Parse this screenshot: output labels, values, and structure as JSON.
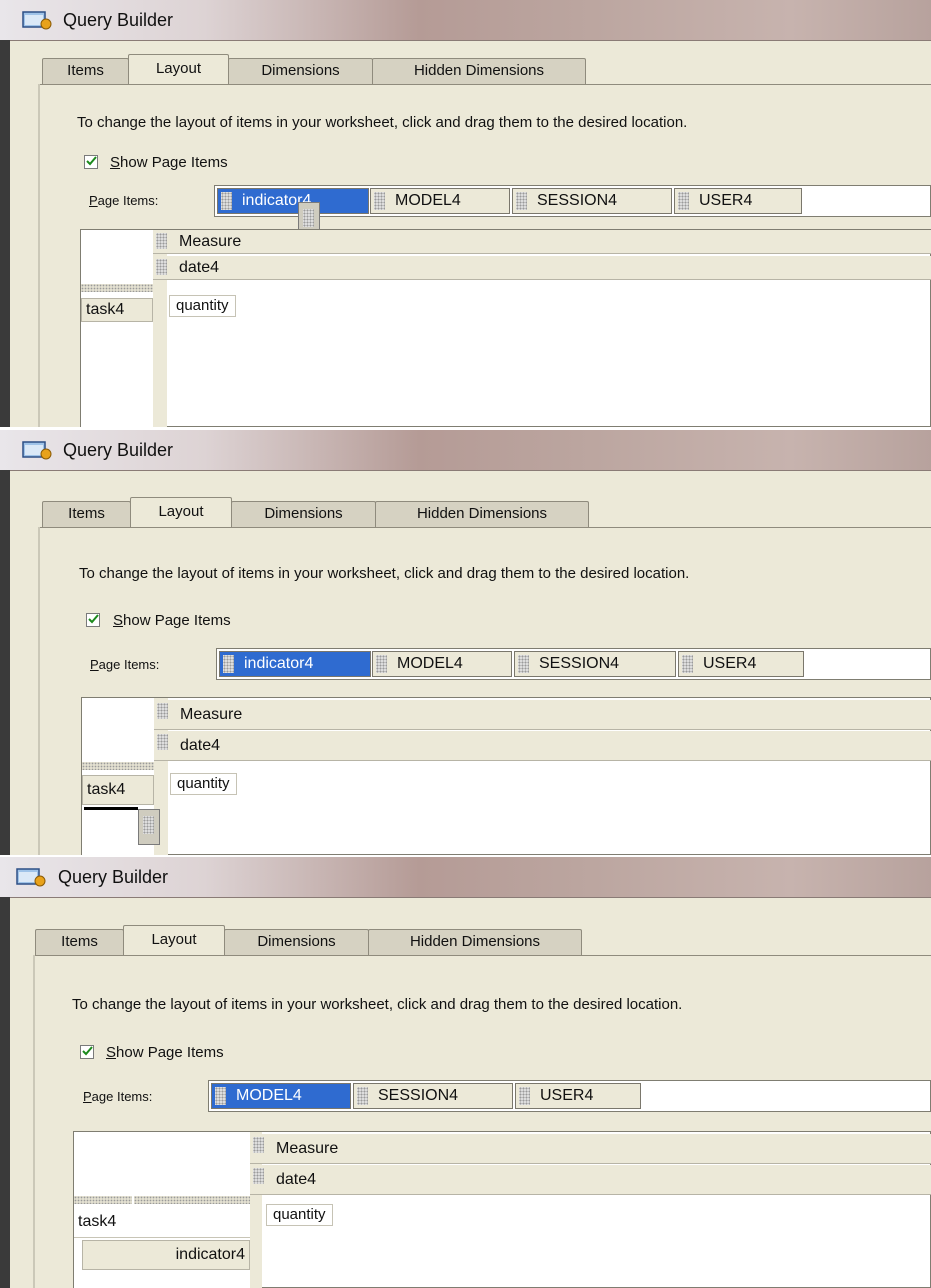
{
  "window": {
    "title": "Query Builder"
  },
  "tabs": [
    "Items",
    "Layout",
    "Dimensions",
    "Hidden Dimensions"
  ],
  "active_tab": "Layout",
  "instructions": "To change the layout of items in your worksheet, click and drag them to the desired location.",
  "show_page_items": {
    "label_underlined": "S",
    "label_rest": "how Page Items",
    "checked": true
  },
  "page_items_label": {
    "underlined": "P",
    "rest": "age Items:"
  },
  "screens": [
    {
      "page_items": [
        "indicator4",
        "MODEL4",
        "SESSION4",
        "USER4"
      ],
      "selected": "indicator4",
      "column_headers": [
        "Measure",
        "date4"
      ],
      "row_headers": [
        "task4"
      ],
      "cell": "quantity"
    },
    {
      "page_items": [
        "indicator4",
        "MODEL4",
        "SESSION4",
        "USER4"
      ],
      "selected": "indicator4",
      "column_headers": [
        "Measure",
        "date4"
      ],
      "row_headers": [
        "task4"
      ],
      "cell": "quantity"
    },
    {
      "page_items": [
        "MODEL4",
        "SESSION4",
        "USER4"
      ],
      "selected": "MODEL4",
      "column_headers": [
        "Measure",
        "date4"
      ],
      "row_headers": [
        "task4",
        "indicator4"
      ],
      "cell": "quantity"
    }
  ]
}
